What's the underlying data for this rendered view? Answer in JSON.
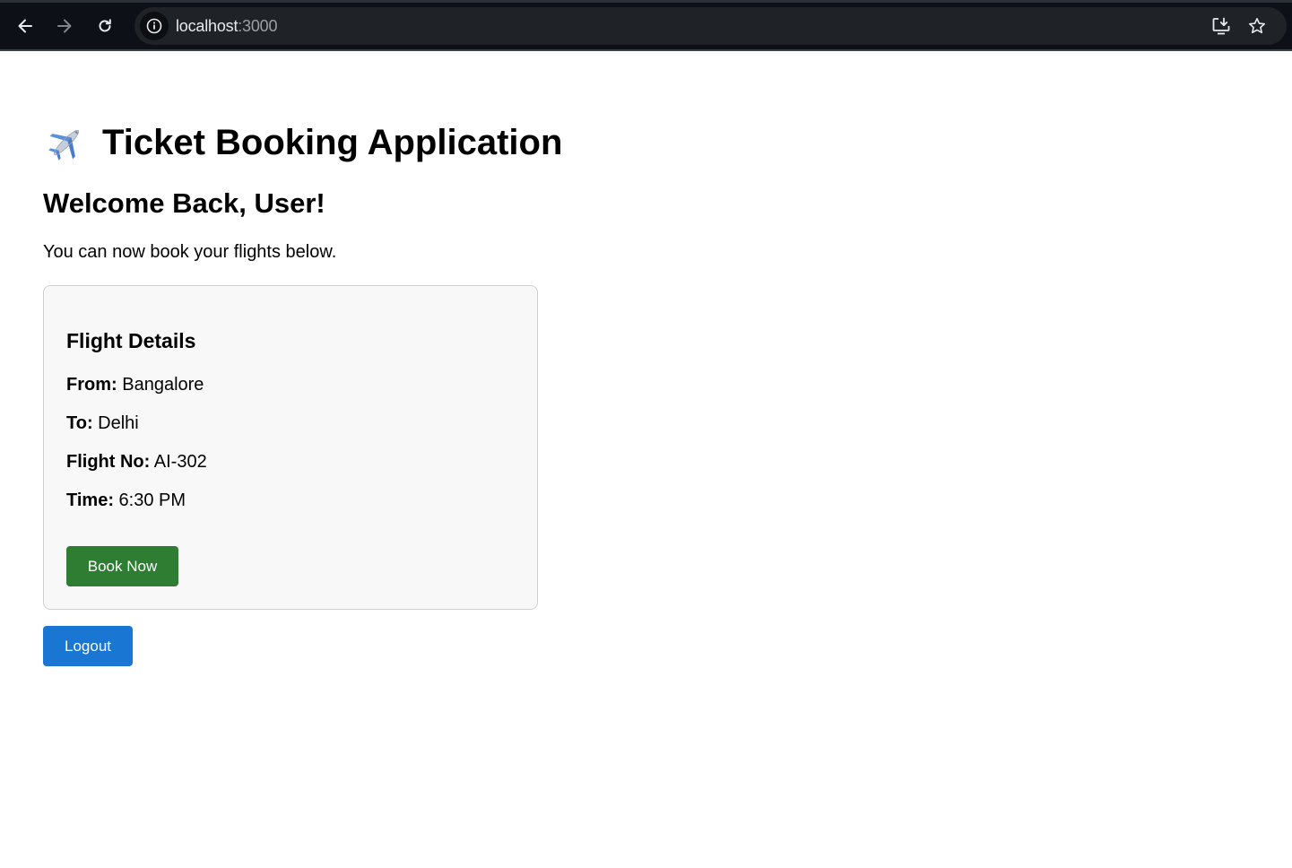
{
  "browser": {
    "url_host": "localhost",
    "url_port": ":3000",
    "icons": [
      "back-arrow-icon",
      "forward-arrow-icon",
      "reload-icon",
      "site-info-icon",
      "install-app-icon",
      "bookmark-star-icon"
    ]
  },
  "page": {
    "title": "Ticket Booking Application",
    "title_icon": "airplane-icon",
    "welcome": "Welcome Back, User!",
    "subtext": "You can now book your flights below."
  },
  "flight_card": {
    "heading": "Flight Details",
    "from_label": "From:",
    "from_value": "Bangalore",
    "to_label": "To:",
    "to_value": "Delhi",
    "flight_no_label": "Flight No:",
    "flight_no_value": "AI-302",
    "time_label": "Time:",
    "time_value": "6:30 PM",
    "book_button": "Book Now"
  },
  "logout_button": "Logout",
  "colors": {
    "book_button": "#2e7d32",
    "logout_button": "#1976d2",
    "card_background": "#f8f8f8",
    "browser_bar": "#0d1016"
  }
}
